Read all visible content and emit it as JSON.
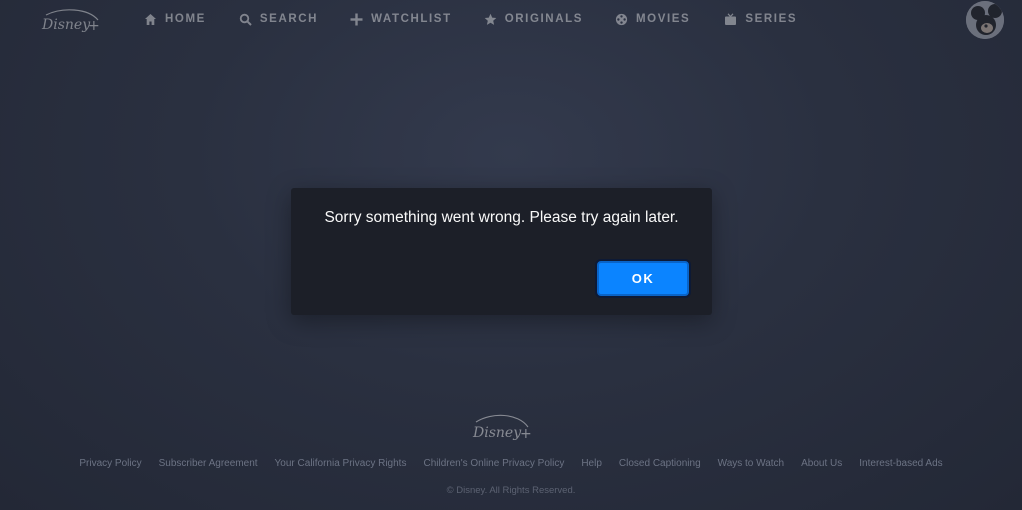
{
  "header": {
    "logo_text": "Disney+",
    "nav": [
      {
        "label": "HOME",
        "icon": "home-icon"
      },
      {
        "label": "SEARCH",
        "icon": "search-icon"
      },
      {
        "label": "WATCHLIST",
        "icon": "plus-icon"
      },
      {
        "label": "ORIGINALS",
        "icon": "star-icon"
      },
      {
        "label": "MOVIES",
        "icon": "film-reel-icon"
      },
      {
        "label": "SERIES",
        "icon": "tv-icon"
      }
    ],
    "avatar_icon": "mickey-avatar-icon"
  },
  "dialog": {
    "message": "Sorry something went wrong. Please try again later.",
    "ok_label": "OK"
  },
  "footer": {
    "logo_text": "Disney+",
    "links": [
      "Privacy Policy",
      "Subscriber Agreement",
      "Your California Privacy Rights",
      "Children's Online Privacy Policy",
      "Help",
      "Closed Captioning",
      "Ways to Watch",
      "About Us",
      "Interest-based Ads"
    ],
    "copyright": "© Disney. All Rights Reserved."
  },
  "colors": {
    "background": "#2a3040",
    "dialog_background": "#1c1f28",
    "accent": "#0b84ff"
  }
}
